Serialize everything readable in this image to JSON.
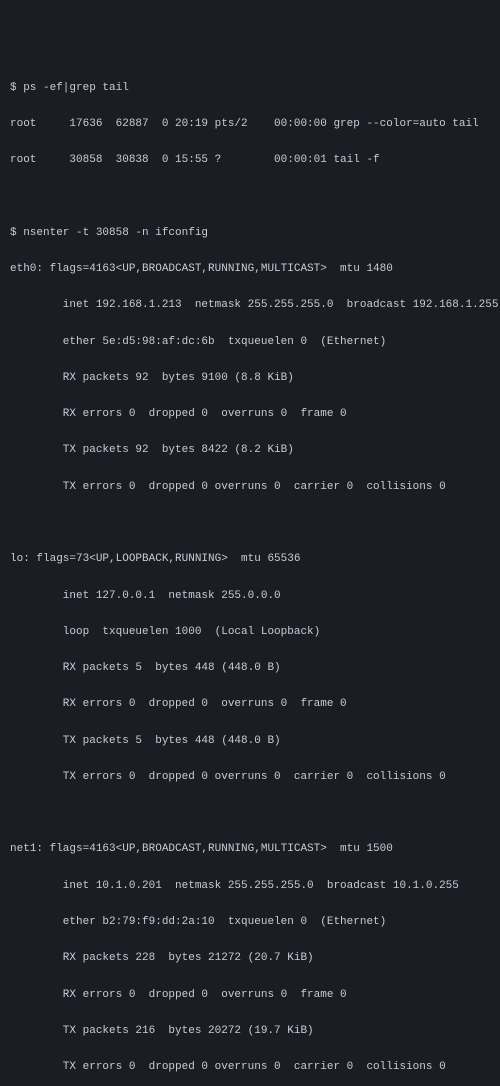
{
  "block1": {
    "prompt": "$ ",
    "cmd": "ps -ef|grep tail",
    "rows": [
      "root     17636  62887  0 20:19 pts/2    00:00:00 grep --color=auto tail",
      "root     30858  30838  0 15:55 ?        00:00:01 tail -f"
    ]
  },
  "block2": {
    "prompt": "$ ",
    "cmd": "nsenter -t 30858 -n ifconfig",
    "eth0": {
      "hdr": "eth0: flags=4163<UP,BROADCAST,RUNNING,MULTICAST>  mtu 1480",
      "l1": "        inet 192.168.1.213  netmask 255.255.255.0  broadcast 192.168.1.255",
      "l2": "        ether 5e:d5:98:af:dc:6b  txqueuelen 0  (Ethernet)",
      "l3": "        RX packets 92  bytes 9100 (8.8 KiB)",
      "l4": "        RX errors 0  dropped 0  overruns 0  frame 0",
      "l5": "        TX packets 92  bytes 8422 (8.2 KiB)",
      "l6": "        TX errors 0  dropped 0 overruns 0  carrier 0  collisions 0"
    },
    "lo": {
      "hdr": "lo: flags=73<UP,LOOPBACK,RUNNING>  mtu 65536",
      "l1": "        inet 127.0.0.1  netmask 255.0.0.0",
      "l2": "        loop  txqueuelen 1000  (Local Loopback)",
      "l3": "        RX packets 5  bytes 448 (448.0 B)",
      "l4": "        RX errors 0  dropped 0  overruns 0  frame 0",
      "l5": "        TX packets 5  bytes 448 (448.0 B)",
      "l6": "        TX errors 0  dropped 0 overruns 0  carrier 0  collisions 0"
    },
    "net1": {
      "hdr": "net1: flags=4163<UP,BROADCAST,RUNNING,MULTICAST>  mtu 1500",
      "l1": "        inet 10.1.0.201  netmask 255.255.255.0  broadcast 10.1.0.255",
      "l2": "        ether b2:79:f9:dd:2a:10  txqueuelen 0  (Ethernet)",
      "l3": "        RX packets 228  bytes 21272 (20.7 KiB)",
      "l4": "        RX errors 0  dropped 0  overruns 0  frame 0",
      "l5": "        TX packets 216  bytes 20272 (19.7 KiB)",
      "l6": "        TX errors 0  dropped 0 overruns 0  carrier 0  collisions 0"
    }
  }
}
